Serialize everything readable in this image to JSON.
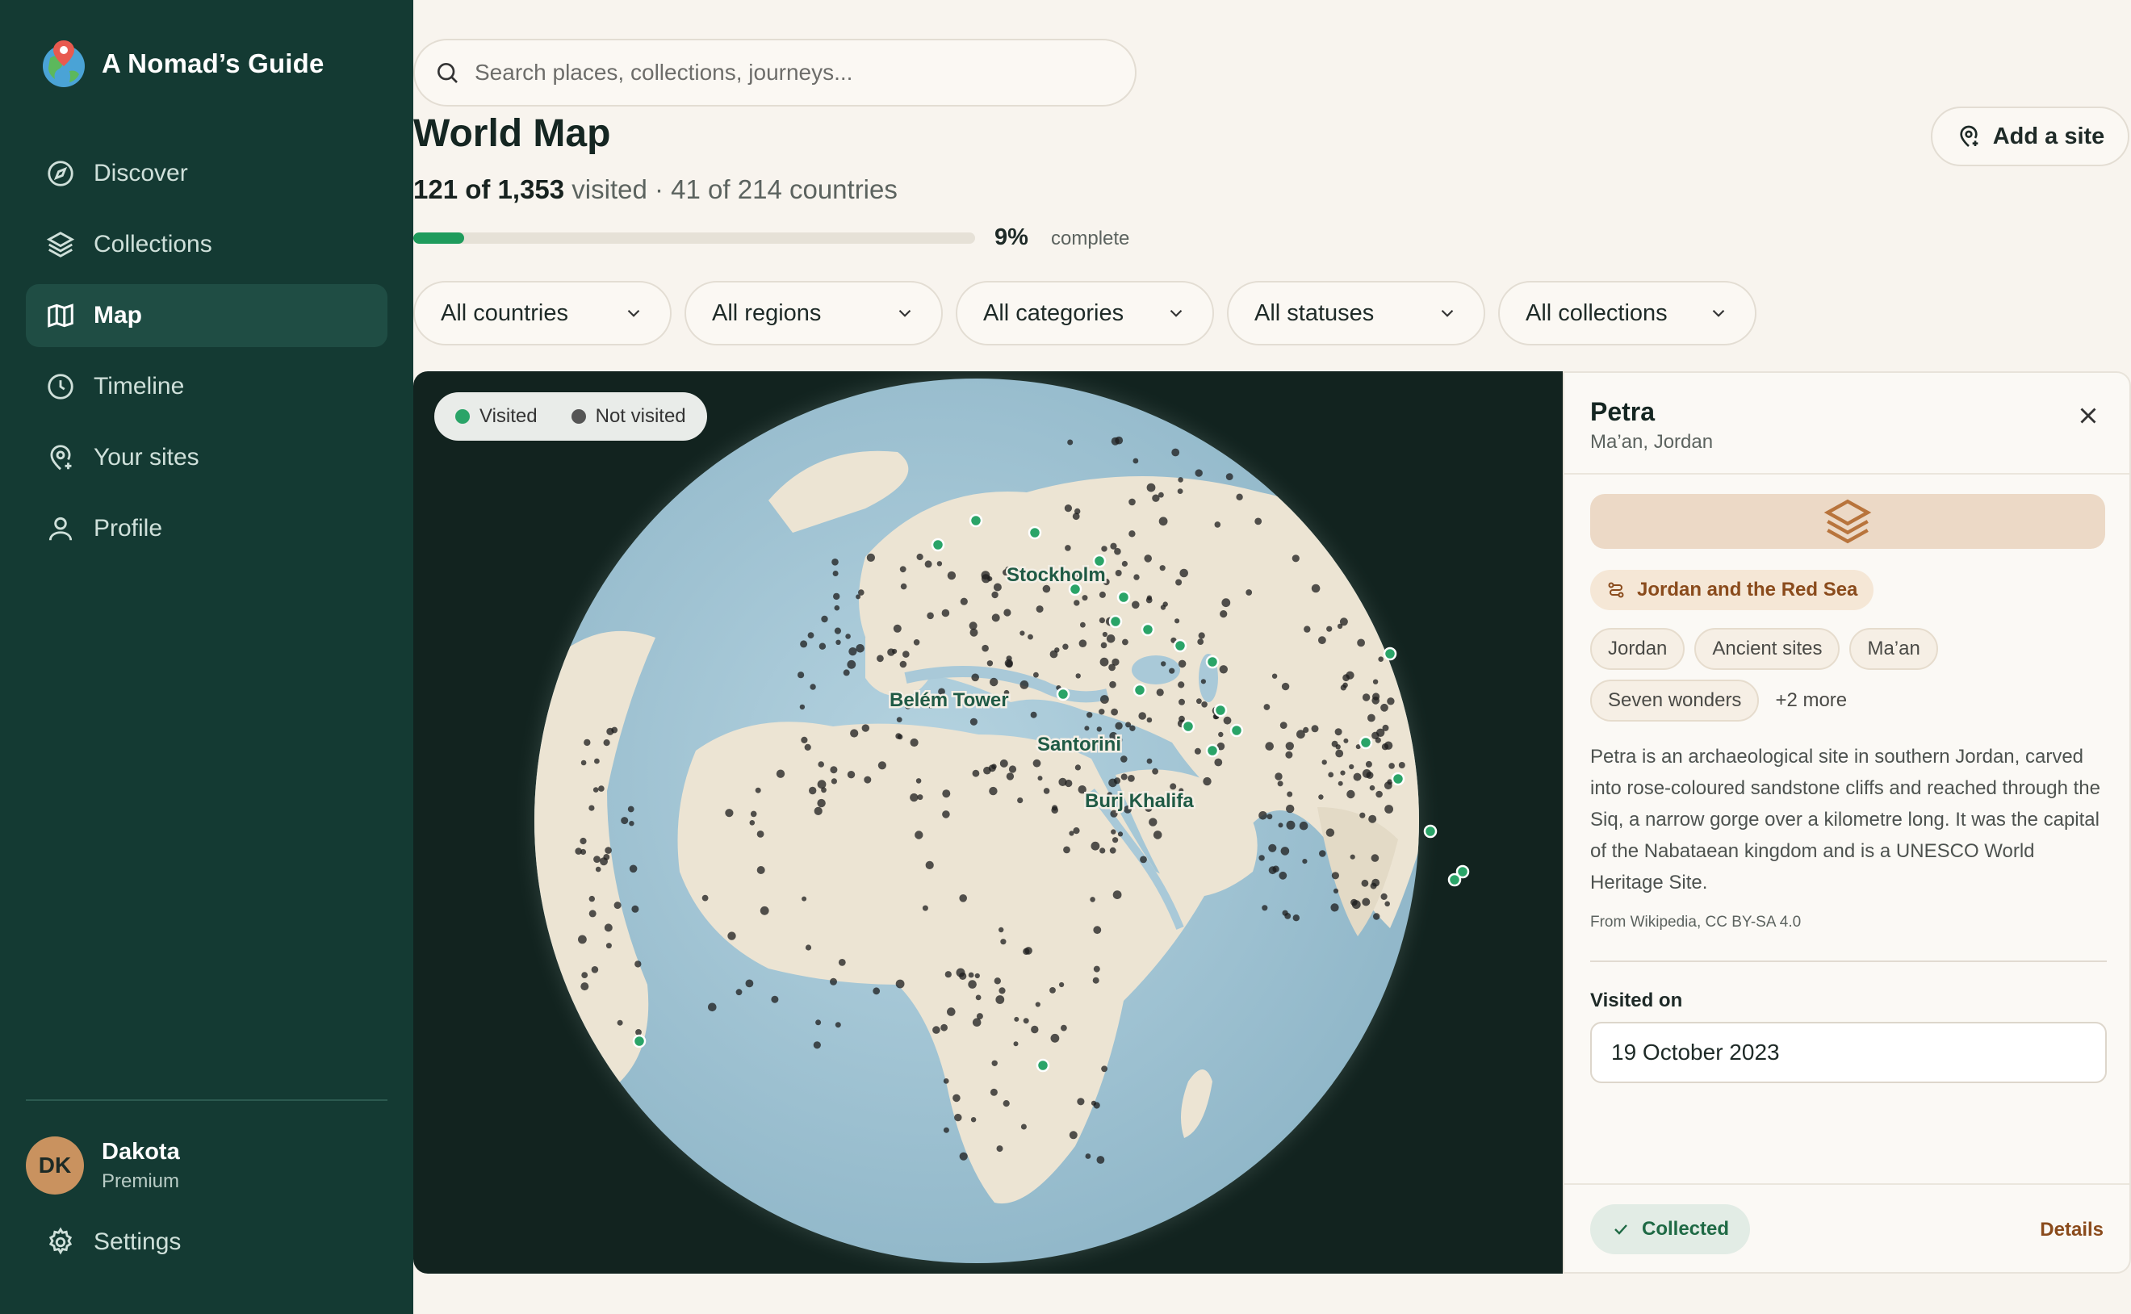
{
  "app": {
    "name": "A Nomad’s Guide",
    "logo_icon": "globe-pin-icon"
  },
  "sidebar": {
    "items": [
      {
        "label": "Discover",
        "icon": "compass-icon",
        "active": false
      },
      {
        "label": "Collections",
        "icon": "layers-icon",
        "active": false
      },
      {
        "label": "Map",
        "icon": "map-icon",
        "active": true
      },
      {
        "label": "Timeline",
        "icon": "clock-icon",
        "active": false
      },
      {
        "label": "Your sites",
        "icon": "location-pin-icon",
        "active": false
      },
      {
        "label": "Profile",
        "icon": "user-icon",
        "active": false
      }
    ],
    "user": {
      "initials": "DK",
      "name": "Dakota",
      "plan": "Premium"
    },
    "settings_label": "Settings"
  },
  "search": {
    "placeholder": "Search places, collections, journeys..."
  },
  "header": {
    "title": "World Map",
    "add_site_label": "Add a site",
    "visited_count": "121 of 1,353",
    "visited_word": "visited",
    "countries_text": " · 41 of 214 countries",
    "progress_fraction": 0.09,
    "progress_percent": "9%",
    "progress_label": "complete"
  },
  "filters": [
    {
      "label": "All countries"
    },
    {
      "label": "All regions"
    },
    {
      "label": "All categories"
    },
    {
      "label": "All statuses"
    },
    {
      "label": "All collections"
    }
  ],
  "map": {
    "legend": {
      "visited": "Visited",
      "not_visited": "Not visited"
    },
    "colors": {
      "visited": "#2aa468",
      "not_visited": "#1c1c1c",
      "ocean": "#a9c9d8",
      "land": "#ece4d3",
      "background": "#12231f"
    },
    "labels": [
      "Stockholm",
      "Belém Tower",
      "Santorini",
      "Burj Khalifa"
    ]
  },
  "detail": {
    "title": "Petra",
    "subtitle": "Ma’an, Jordan",
    "collection": "Jordan and the Red Sea",
    "tags": [
      "Jordan",
      "Ancient sites",
      "Ma’an",
      "Seven wonders"
    ],
    "more_tags": "+2 more",
    "description": "Petra is an archaeological site in southern Jordan, carved into rose-coloured sandstone cliffs and reached through the Siq, a narrow gorge over a kilometre long. It was the capital of the Nabataean kingdom and is a UNESCO World Heritage Site.",
    "source": "From Wikipedia, CC BY-SA 4.0",
    "visited_label": "Visited on",
    "visited_date": "19 October 2023",
    "status_label": "Collected",
    "details_label": "Details"
  }
}
